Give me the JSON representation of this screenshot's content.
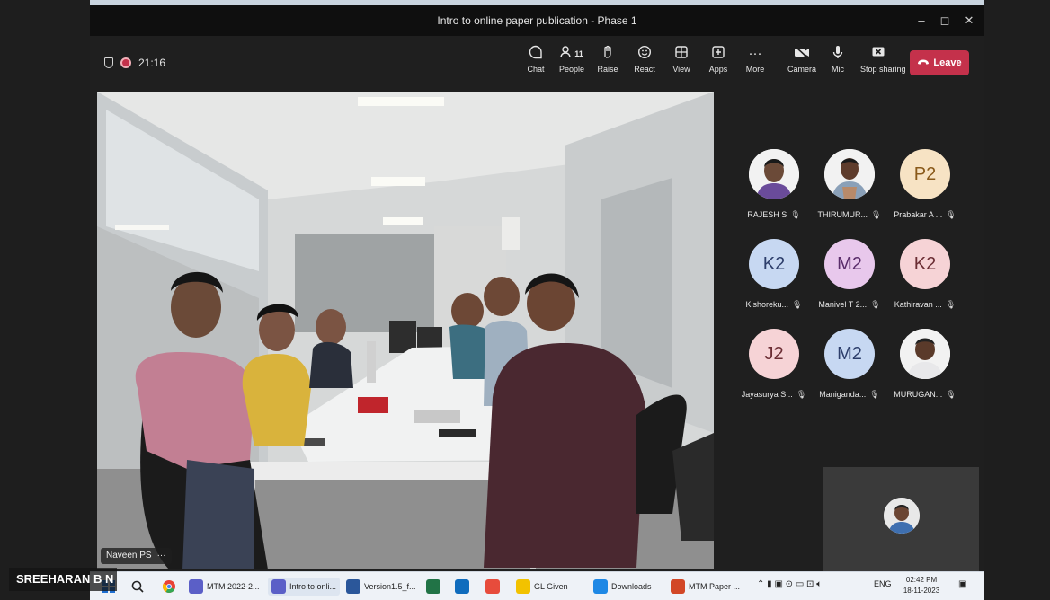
{
  "window": {
    "title": "Intro to online paper publication - Phase 1",
    "controls": {
      "minimize": "–",
      "maximize": "◻",
      "close": "✕"
    }
  },
  "status": {
    "timer": "21:16"
  },
  "toolbar": {
    "chat": {
      "label": "Chat",
      "icon": "chat-icon"
    },
    "people": {
      "label": "People",
      "count": "11",
      "icon": "people-icon"
    },
    "raise": {
      "label": "Raise",
      "icon": "hand-icon"
    },
    "react": {
      "label": "React",
      "icon": "smile-icon"
    },
    "view": {
      "label": "View",
      "icon": "view-icon"
    },
    "apps": {
      "label": "Apps",
      "icon": "apps-icon"
    },
    "more": {
      "label": "More",
      "icon": "more-icon"
    },
    "camera": {
      "label": "Camera",
      "icon": "camera-icon"
    },
    "mic": {
      "label": "Mic",
      "icon": "mic-icon"
    },
    "stop_sharing": {
      "label": "Stop sharing",
      "icon": "stop-share-icon"
    },
    "leave": {
      "label": "Leave",
      "color": "#c4314b"
    }
  },
  "video": {
    "speaker_name": "Naveen PS",
    "options": "···"
  },
  "participants": [
    {
      "name": "RAJESH S",
      "initials": "",
      "photo": true,
      "bg": "#f2f2f2"
    },
    {
      "name": "THIRUMUR...",
      "initials": "",
      "photo": true,
      "bg": "#f2f2f2"
    },
    {
      "name": "Prabakar A ...",
      "initials": "P2",
      "photo": false,
      "bg": "#f7e3c4"
    },
    {
      "name": "Kishoreku...",
      "initials": "K2",
      "photo": false,
      "bg": "#c7d8f2"
    },
    {
      "name": "Manivel T 2...",
      "initials": "M2",
      "photo": false,
      "bg": "#e8c8ec"
    },
    {
      "name": "Kathiravan ...",
      "initials": "K2",
      "photo": false,
      "bg": "#f6d3d6"
    },
    {
      "name": "Jayasurya S...",
      "initials": "J2",
      "photo": false,
      "bg": "#f6d3d6"
    },
    {
      "name": "Manigandа...",
      "initials": "M2",
      "photo": false,
      "bg": "#c7d8f2"
    },
    {
      "name": "MURUGAN...",
      "initials": "",
      "photo": true,
      "bg": "#f2f2f2"
    }
  ],
  "presenter": {
    "name": "SREEHARAN B N"
  },
  "taskbar": {
    "items": [
      {
        "label": "MTM 2022-2...",
        "color": "#5b5fc7"
      },
      {
        "label": "Intro to onli...",
        "color": "#5b5fc7"
      },
      {
        "label": "Version1.5_f...",
        "color": "#2b579a"
      },
      {
        "label": "",
        "color": "#217346"
      },
      {
        "label": "",
        "color": "#0f6cbd"
      },
      {
        "label": "",
        "color": "#e74c3c"
      },
      {
        "label": "GL Given",
        "color": "#f2c200"
      },
      {
        "label": "Downloads",
        "color": "#1e88e5"
      },
      {
        "label": "MTM Paper ...",
        "color": "#d24726"
      }
    ],
    "tray_lang": "ENG",
    "time": "02:42 PM",
    "date": "18-11-2023"
  }
}
